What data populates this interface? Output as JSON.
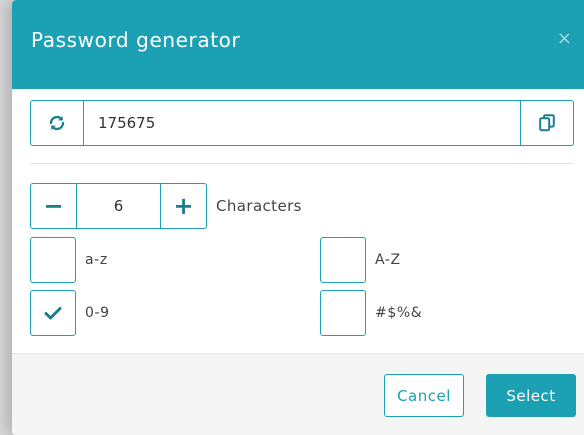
{
  "dialog": {
    "title": "Password generator",
    "close_label": "×"
  },
  "password": {
    "value": "175675",
    "refresh_icon": "refresh-icon",
    "copy_icon": "copy-icon"
  },
  "length": {
    "value": "6",
    "minus": "−",
    "plus": "+",
    "label": "Characters"
  },
  "options": [
    {
      "label": "a-z",
      "checked": false
    },
    {
      "label": "A-Z",
      "checked": false
    },
    {
      "label": "0-9",
      "checked": true
    },
    {
      "label": "#$%&",
      "checked": false
    }
  ],
  "footer": {
    "cancel_label": "Cancel",
    "select_label": "Select"
  },
  "colors": {
    "accent": "#1ba1b3",
    "icon": "#1a7e8d"
  }
}
